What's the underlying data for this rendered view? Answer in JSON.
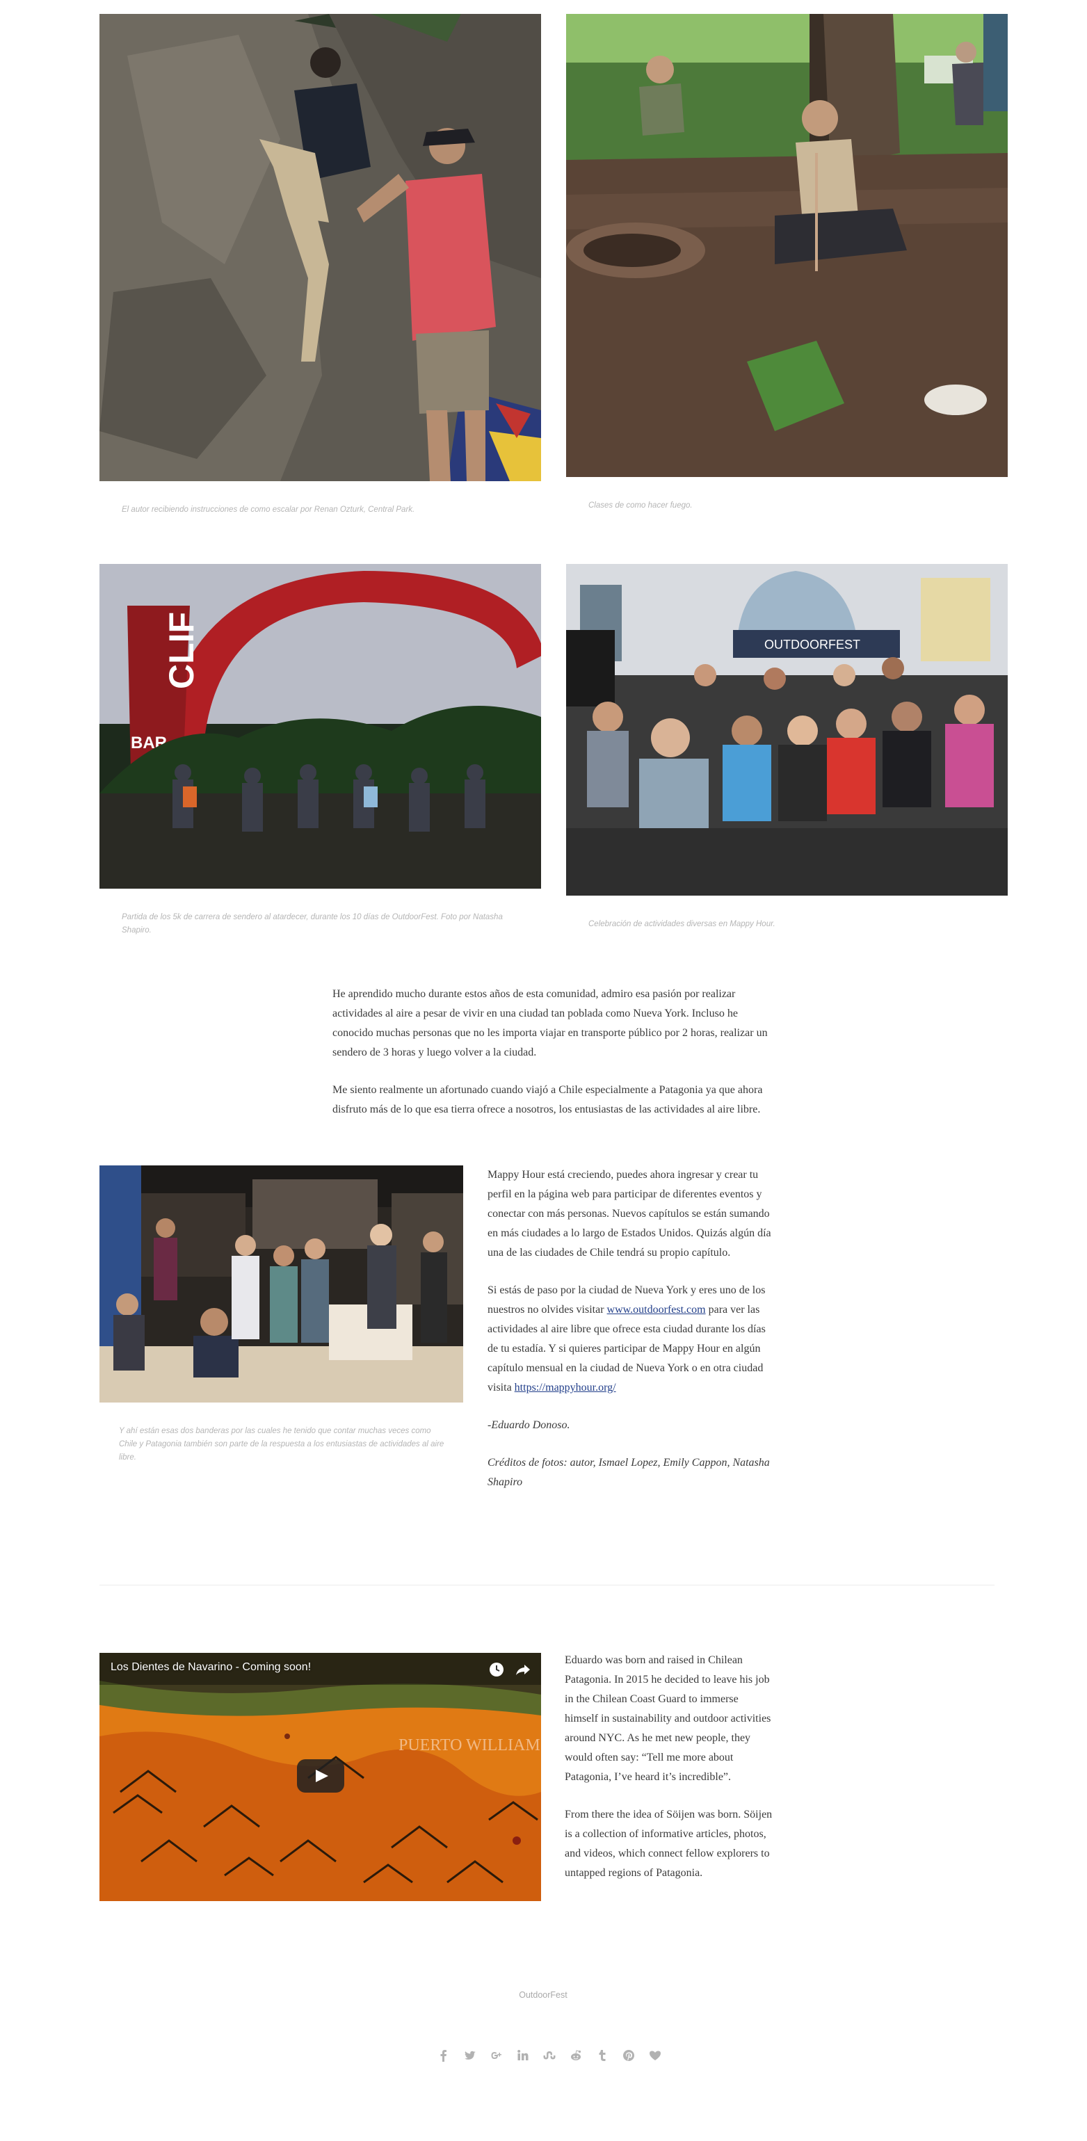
{
  "gallery": {
    "captions": [
      "El autor recibiendo instrucciones de como escalar por Renan Ozturk, Central Park.",
      "Clases de como hacer fuego.",
      "Partida de los 5k de carrera de sendero al atardecer, durante los 10 días de OutdoorFest. Foto por Natasha Shapiro.",
      "Celebración de actividades diversas en Mappy Hour."
    ],
    "clif_sign": "CLIF",
    "clif_sub": "BAR",
    "outdoorfest_banner": "OUTDOORFEST"
  },
  "article": {
    "intro_paragraphs": [
      "He aprendido mucho durante estos años de esta comunidad, admiro esa pasión por realizar actividades al aire a pesar de vivir en una ciudad tan poblada como Nueva York. Incluso he conocido muchas personas que no les importa viajar en transporte público por 2 horas, realizar un sendero de 3 horas y luego volver a la ciudad.",
      "Me siento realmente un afortunado cuando viajó a Chile especialmente a Patagonia ya que ahora disfruto más de lo que esa tierra ofrece a nosotros, los entusiastas de las actividades al aire libre."
    ],
    "side_caption": "Y ahí están esas dos banderas por las cuales he tenido que contar muchas veces como Chile y Patagonia también son parte de la respuesta a los entusiastas de actividades al aire libre.",
    "para3": "Mappy Hour está creciendo, puedes ahora ingresar y crear tu perfil en la página web para participar de diferentes eventos y conectar con más personas. Nuevos capítulos se están sumando en más ciudades a lo largo de Estados Unidos. Quizás algún día una de las ciudades de Chile tendrá su propio capítulo.",
    "para4_a": "Si estás de paso por la ciudad de Nueva York y eres uno de los nuestros no olvides visitar ",
    "para4_link1": "www.outdoorfest.com",
    "para4_b": " para ver las actividades al aire libre que ofrece esta ciudad durante los días de tu estadía. Y si quieres participar de Mappy Hour en algún capítulo mensual en la ciudad de Nueva York o en otra ciudad visita ",
    "para4_link2": "https://mappyhour.org/",
    "signature": "-Eduardo Donoso.",
    "credits": "Créditos de fotos: autor, Ismael Lopez, Emily Cappon, Natasha Shapiro"
  },
  "author": {
    "video_title": "Los Dientes de Navarino - Coming soon!",
    "map_label": "PUERTO WILLIAMS",
    "bio_1": "Eduardo was born and raised in Chilean Patagonia. In 2015 he decided to leave his job in the Chilean Coast Guard to immerse himself in sustainability and outdoor activities around NYC. As he met new people, they would often say: “Tell me more about Patagonia, I’ve heard it’s incredible”.",
    "bio_2": "From there the idea of Söijen was born. Söijen is a collection of informative articles, photos, and videos, which connect fellow explorers to untapped regions of Patagonia."
  },
  "footer": {
    "tag_label": "OutdoorFest",
    "share_icons": [
      "facebook-icon",
      "twitter-icon",
      "google-plus-icon",
      "linkedin-icon",
      "stumbleupon-icon",
      "reddit-icon",
      "tumblr-icon",
      "pinterest-icon",
      "heart-icon"
    ]
  },
  "colors": {
    "link": "#223f8a",
    "caption": "#b5b5b5",
    "icon": "#b2b2b2"
  }
}
